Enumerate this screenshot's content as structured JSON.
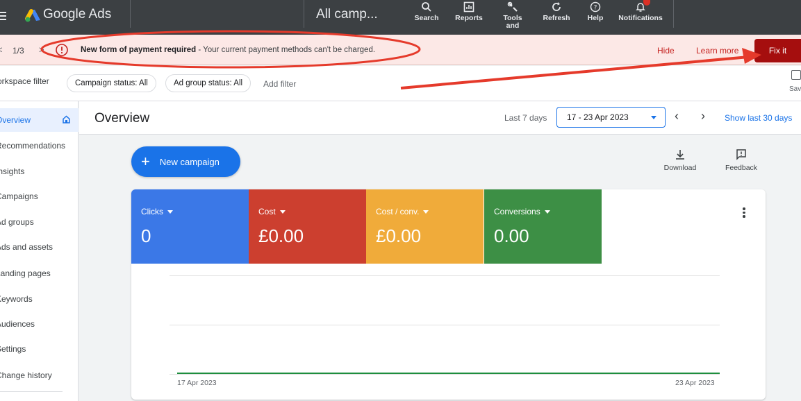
{
  "app": {
    "brand": "Google Ads",
    "campaign_selector": "All camp..."
  },
  "toolbar": {
    "buttons": [
      {
        "label": "Search",
        "icon": "search-icon"
      },
      {
        "label": "Reports",
        "icon": "reports-icon"
      },
      {
        "label": "Tools and",
        "icon": "tools-icon"
      },
      {
        "label": "Refresh",
        "icon": "refresh-icon"
      },
      {
        "label": "Help",
        "icon": "help-icon"
      },
      {
        "label": "Notifications",
        "icon": "notifications-icon"
      }
    ]
  },
  "alert": {
    "pager": "1/3",
    "title": "New form of payment required",
    "message": " - Your current payment methods can't be charged.",
    "hide_label": "Hide",
    "learn_more_label": "Learn more",
    "fix_label": "Fix it"
  },
  "filters": {
    "workspace_label": "orkspace filter",
    "chips": [
      "Campaign status: All",
      "Ad group status: All"
    ],
    "add_filter": "Add filter",
    "save_label": "Sav"
  },
  "sidenav": {
    "items": [
      "Overview",
      "Recommendations",
      "Insights",
      "Campaigns",
      "Ad groups",
      "Ads and assets",
      "Landing pages",
      "Keywords",
      "Audiences",
      "Settings",
      "Change history"
    ],
    "active_index": 0
  },
  "header": {
    "title": "Overview",
    "range_label": "Last 7 days",
    "date_range": "17 - 23 Apr 2023",
    "show_last_30": "Show last 30 days"
  },
  "content": {
    "new_campaign": "New campaign",
    "download_label": "Download",
    "feedback_label": "Feedback"
  },
  "metrics": [
    {
      "label": "Clicks",
      "value": "0",
      "color": "#3b78e7"
    },
    {
      "label": "Cost",
      "value": "£0.00",
      "color": "#cc3f2f"
    },
    {
      "label": "Cost / conv.",
      "value": "£0.00",
      "color": "#f0ab3a"
    },
    {
      "label": "Conversions",
      "value": "0.00",
      "color": "#3d8f45"
    }
  ],
  "chart_data": {
    "type": "line",
    "x": [
      "17 Apr 2023",
      "23 Apr 2023"
    ],
    "series": [
      {
        "values": [
          0,
          0
        ],
        "color": "#1e8e3e"
      }
    ]
  },
  "colors": {
    "topbar": "#3c4043",
    "accent": "#1a73e8",
    "alert_bg": "#fce8e6",
    "danger": "#c5221f",
    "annotation": "#e53a2b"
  }
}
